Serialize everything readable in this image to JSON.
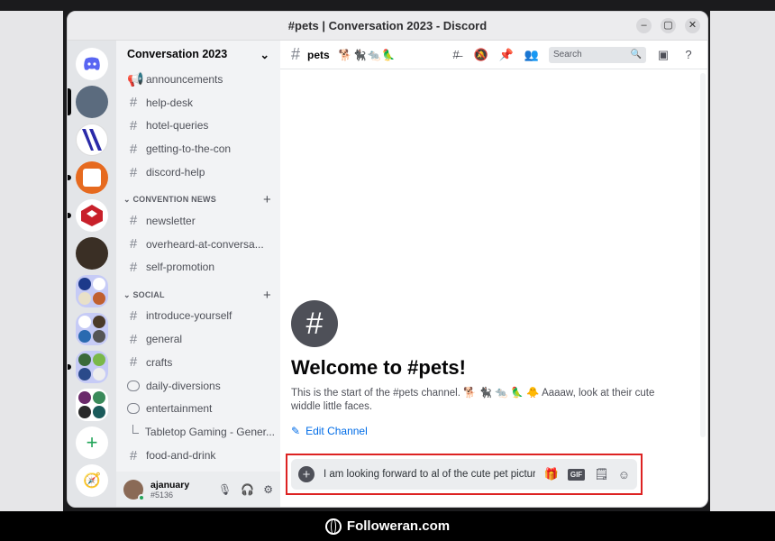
{
  "window": {
    "title": "#pets | Conversation 2023 - Discord"
  },
  "window_buttons": {
    "minimize": "–",
    "maximize": "▢",
    "close": "✕"
  },
  "guild": {
    "name": "Conversation 2023"
  },
  "channels_top": [
    "announcements",
    "help-desk",
    "hotel-queries",
    "getting-to-the-con",
    "discord-help"
  ],
  "categories": {
    "convention_news": "CONVENTION NEWS",
    "social": "SOCIAL"
  },
  "channels_convention_news": [
    "newsletter",
    "overheard-at-conversa...",
    "self-promotion"
  ],
  "channels_social": [
    {
      "name": "introduce-yourself",
      "kind": "text"
    },
    {
      "name": "general",
      "kind": "text"
    },
    {
      "name": "crafts",
      "kind": "text"
    },
    {
      "name": "daily-diversions",
      "kind": "forum"
    },
    {
      "name": "entertainment",
      "kind": "forum"
    },
    {
      "name": "Tabletop Gaming - Gener...",
      "kind": "thread"
    },
    {
      "name": "food-and-drink",
      "kind": "text"
    }
  ],
  "user": {
    "name": "ajanuary",
    "tag": "#5136"
  },
  "topbar": {
    "channel": "pets",
    "emojis": "🐕🐈‍⬛🐀🦜",
    "search_placeholder": "Search"
  },
  "welcome": {
    "title": "Welcome to #pets!",
    "description": "This is the start of the #pets channel. 🐕 🐈‍⬛ 🐀 🦜 🐥 Aaaaw, look at their cute widdle little faces.",
    "edit_label": "Edit Channel"
  },
  "composer": {
    "text": "I am looking forward to al of the cute pet pictures."
  },
  "footer": {
    "brand": "Followeran.com"
  },
  "colors": {
    "accent": "#5865f2",
    "online": "#23a55a",
    "link": "#006ce7",
    "highlight": "#dd2222"
  }
}
